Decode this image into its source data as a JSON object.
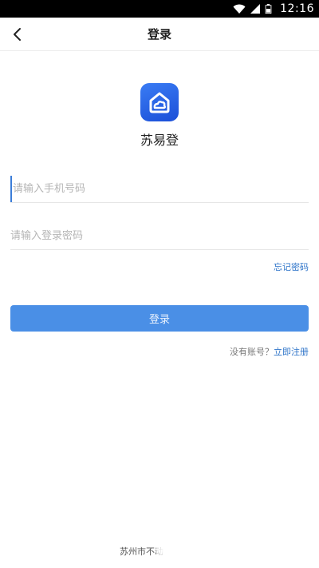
{
  "status_bar": {
    "time": "12:16",
    "icons": [
      "wifi-icon",
      "signal-icon",
      "battery-icon"
    ]
  },
  "nav": {
    "title": "登录",
    "back_icon": "chevron-left-icon"
  },
  "app": {
    "name": "苏易登",
    "logo_icon": "house-cloud-icon"
  },
  "form": {
    "phone_placeholder": "请输入手机号码",
    "phone_value": "",
    "password_placeholder": "请输入登录密码",
    "password_value": "",
    "forgot_label": "忘记密码",
    "login_label": "登录",
    "no_account_label": "没有账号？",
    "register_label": "立即注册"
  },
  "footer": {
    "text": "苏州市不动"
  },
  "colors": {
    "accent": "#4a8fe6",
    "link": "#2e74c9",
    "logo": "#2a62e6"
  }
}
